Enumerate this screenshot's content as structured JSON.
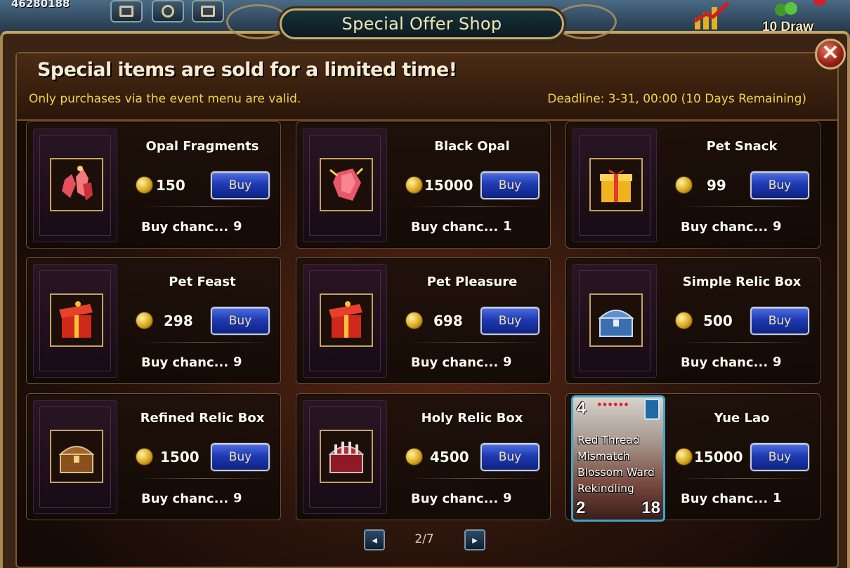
{
  "top": {
    "player_id": "46280188",
    "draw_label": "10 Draw"
  },
  "window": {
    "title": "Special Offer Shop",
    "headline": "Special items are sold for a limited time!",
    "note": "Only purchases via the event menu are valid.",
    "deadline": "Deadline: 3-31, 00:00 (10 Days Remaining)",
    "close_label": "✕"
  },
  "items": [
    {
      "name": "Opal Fragments",
      "price": "150",
      "buy_label": "Buy",
      "chance_label": "Buy chanc...",
      "chance": "9",
      "icon": "opal-fragments-icon"
    },
    {
      "name": "Black Opal",
      "price": "15000",
      "buy_label": "Buy",
      "chance_label": "Buy chanc...",
      "chance": "1",
      "icon": "black-opal-icon"
    },
    {
      "name": "Pet Snack",
      "price": "99",
      "buy_label": "Buy",
      "chance_label": "Buy chanc...",
      "chance": "9",
      "icon": "gift-box-icon"
    },
    {
      "name": "Pet Feast",
      "price": "298",
      "buy_label": "Buy",
      "chance_label": "Buy chanc...",
      "chance": "9",
      "icon": "red-gift-box-icon"
    },
    {
      "name": "Pet Pleasure",
      "price": "698",
      "buy_label": "Buy",
      "chance_label": "Buy chanc...",
      "chance": "9",
      "icon": "red-gift-box-icon"
    },
    {
      "name": "Simple Relic Box",
      "price": "500",
      "buy_label": "Buy",
      "chance_label": "Buy chanc...",
      "chance": "9",
      "icon": "blue-chest-icon"
    },
    {
      "name": "Refined Relic Box",
      "price": "1500",
      "buy_label": "Buy",
      "chance_label": "Buy chanc...",
      "chance": "9",
      "icon": "gold-chest-icon"
    },
    {
      "name": "Holy Relic Box",
      "price": "4500",
      "buy_label": "Buy",
      "chance_label": "Buy chanc...",
      "chance": "9",
      "icon": "red-chest-icon"
    },
    {
      "name": "Yue Lao",
      "price": "15000",
      "buy_label": "Buy",
      "chance_label": "Buy chanc...",
      "chance": "1",
      "icon": "hero-card-icon"
    }
  ],
  "hero_card": {
    "level": "4",
    "skills": [
      "Red Thread",
      "Mismatch",
      "Blossom Ward",
      "Rekindling"
    ],
    "attack": "2",
    "hp": "18"
  },
  "pager": {
    "page": "2/7",
    "prev_icon": "◄",
    "next_icon": "►"
  },
  "colors": {
    "accent_gold": "#f2d34a",
    "buy_button_blue": "#1f3ab3",
    "frame_gold": "#c5a55b"
  }
}
